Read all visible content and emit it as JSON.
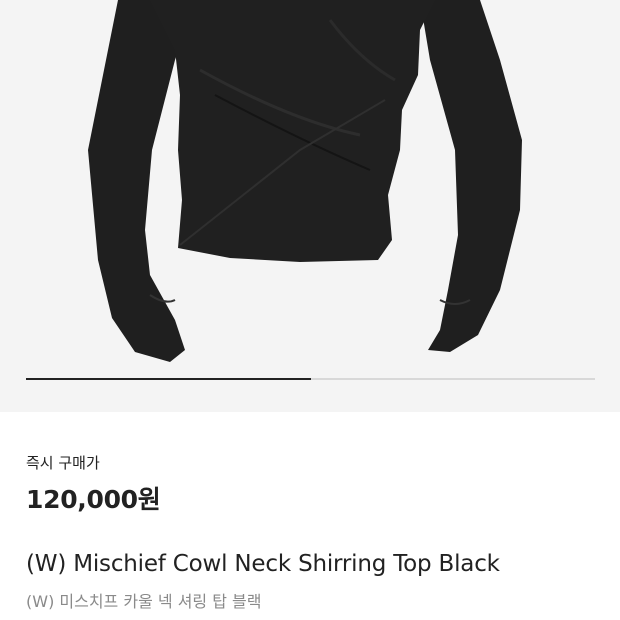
{
  "product": {
    "image_alt": "(W) Mischief Cowl Neck Shirring Top Black",
    "image_index": 1,
    "image_count": 2
  },
  "carousel": {
    "progress": 0.5
  },
  "purchase": {
    "price_label": "즉시 구매가",
    "price": "120,000원"
  },
  "title": {
    "english": "(W) Mischief Cowl Neck Shirring Top Black",
    "korean": "(W) 미스치프 카울 넥 셔링 탑 블랙"
  },
  "colors": {
    "image_background": "#f4f4f4",
    "garment": "#1f1f1f",
    "text_primary": "#222222",
    "text_secondary": "#8a8a8a",
    "indicator_active": "#222222",
    "indicator_track": "#d8d8d8"
  }
}
